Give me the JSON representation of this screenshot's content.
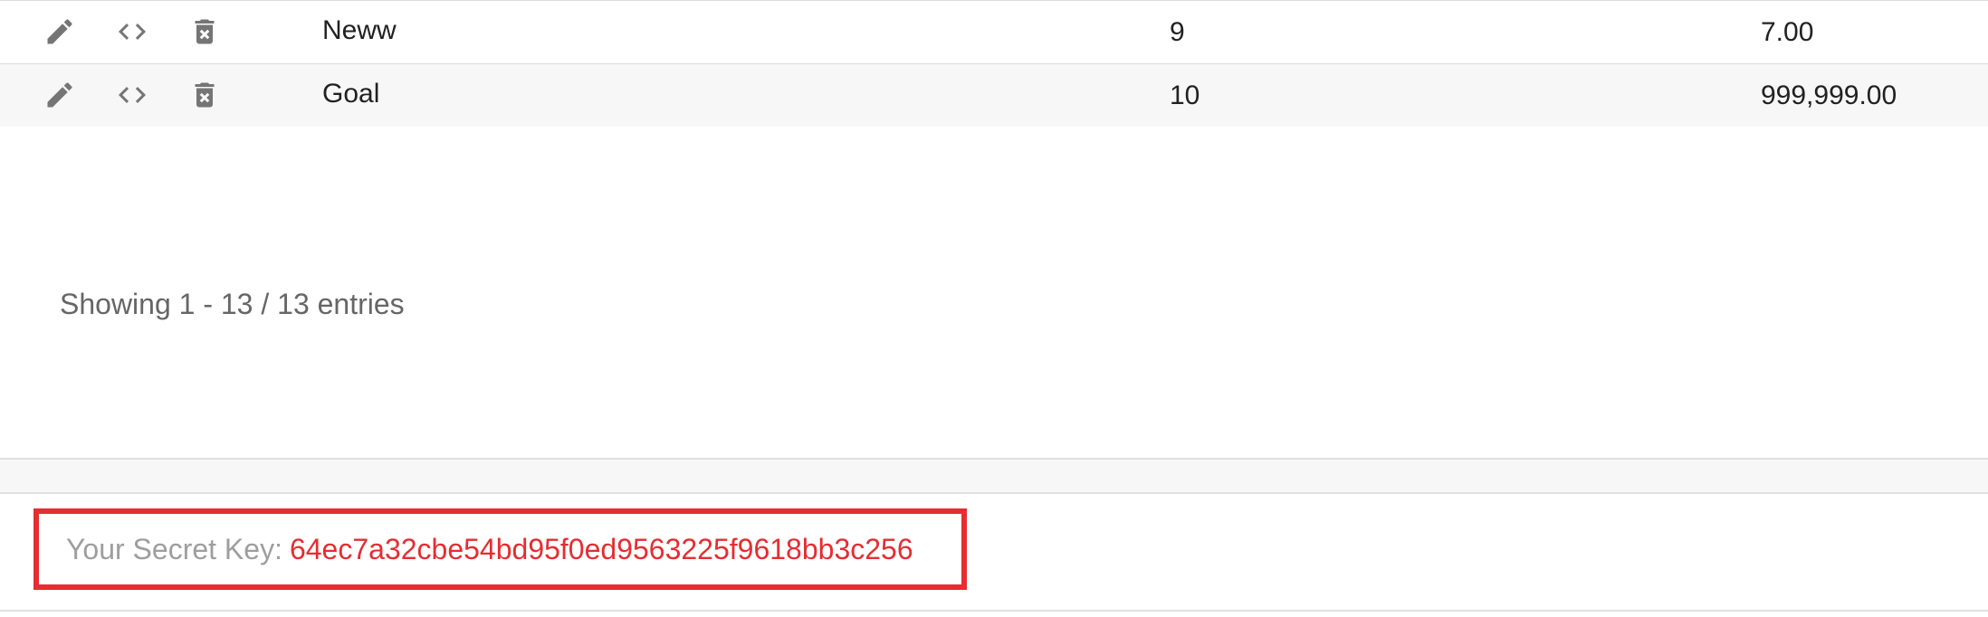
{
  "table": {
    "rows": [
      {
        "name": "Neww",
        "number": "9",
        "amount": "7.00",
        "icons": [
          "pencil-icon",
          "code-icon",
          "delete-icon"
        ]
      },
      {
        "name": "Goal",
        "number": "10",
        "amount": "999,999.00",
        "icons": [
          "pencil-icon",
          "code-icon",
          "delete-icon"
        ]
      }
    ]
  },
  "pagination": {
    "info": "Showing 1 - 13 / 13 entries"
  },
  "secret": {
    "label": "Your Secret Key:",
    "value": "64ec7a32cbe54bd95f0ed9563225f9618bb3c256"
  },
  "colors": {
    "highlight_border": "#e52d32",
    "secret_value": "#e52d32",
    "icon": "#757575",
    "alt_row": "#f7f7f7"
  }
}
